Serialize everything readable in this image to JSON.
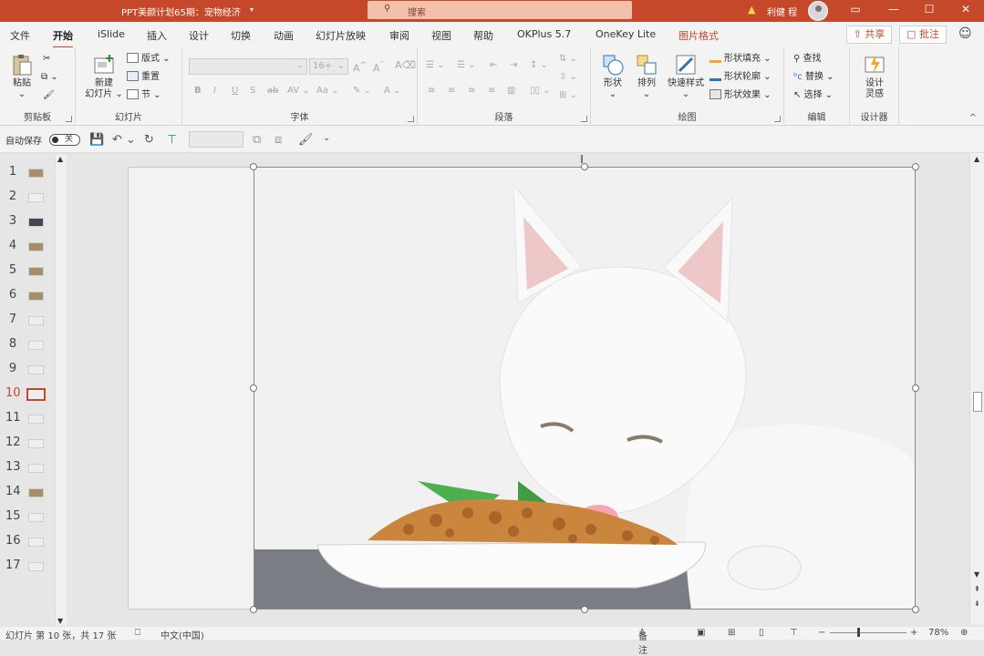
{
  "titlebar": {
    "doc_title": "PPT美颜计划65期：宠物经济",
    "search_placeholder": "搜索",
    "user_name": "利健 程"
  },
  "menu": {
    "tabs": [
      "文件",
      "开始",
      "iSlide",
      "插入",
      "设计",
      "切换",
      "动画",
      "幻灯片放映",
      "审阅",
      "视图",
      "帮助",
      "OKPlus 5.7",
      "OneKey Lite",
      "图片格式"
    ],
    "active": "开始",
    "share": "共享",
    "comment": "批注"
  },
  "ribbon": {
    "clipboard": {
      "label": "剪贴板",
      "paste": "粘贴"
    },
    "slides": {
      "label": "幻灯片",
      "new_slide": "新建",
      "new_slide2": "幻灯片",
      "layout": "版式",
      "reset": "重置",
      "section": "节"
    },
    "font": {
      "label": "字体",
      "size": "16+"
    },
    "paragraph": {
      "label": "段落"
    },
    "drawing": {
      "label": "绘图",
      "shape": "形状",
      "arrange": "排列",
      "quick_styles": "快速样式",
      "fill": "形状填充",
      "outline": "形状轮廓",
      "effects": "形状效果"
    },
    "editing": {
      "label": "编辑",
      "find": "查找",
      "replace": "替换",
      "select": "选择"
    },
    "designer": {
      "label": "设计器",
      "ideas": "设计",
      "ideas2": "灵感"
    }
  },
  "qat": {
    "autosave": "自动保存",
    "autosave_state": "关"
  },
  "thumbnails": {
    "numbers": [
      "1",
      "2",
      "3",
      "4",
      "5",
      "6",
      "7",
      "8",
      "9",
      "10",
      "11",
      "12",
      "13",
      "14",
      "15",
      "16",
      "17"
    ],
    "selected": "10"
  },
  "statusbar": {
    "slide_info": "幻灯片 第 10 张，共 17 张",
    "language": "中文(中国)",
    "notes": "备注",
    "zoom": "78%"
  }
}
